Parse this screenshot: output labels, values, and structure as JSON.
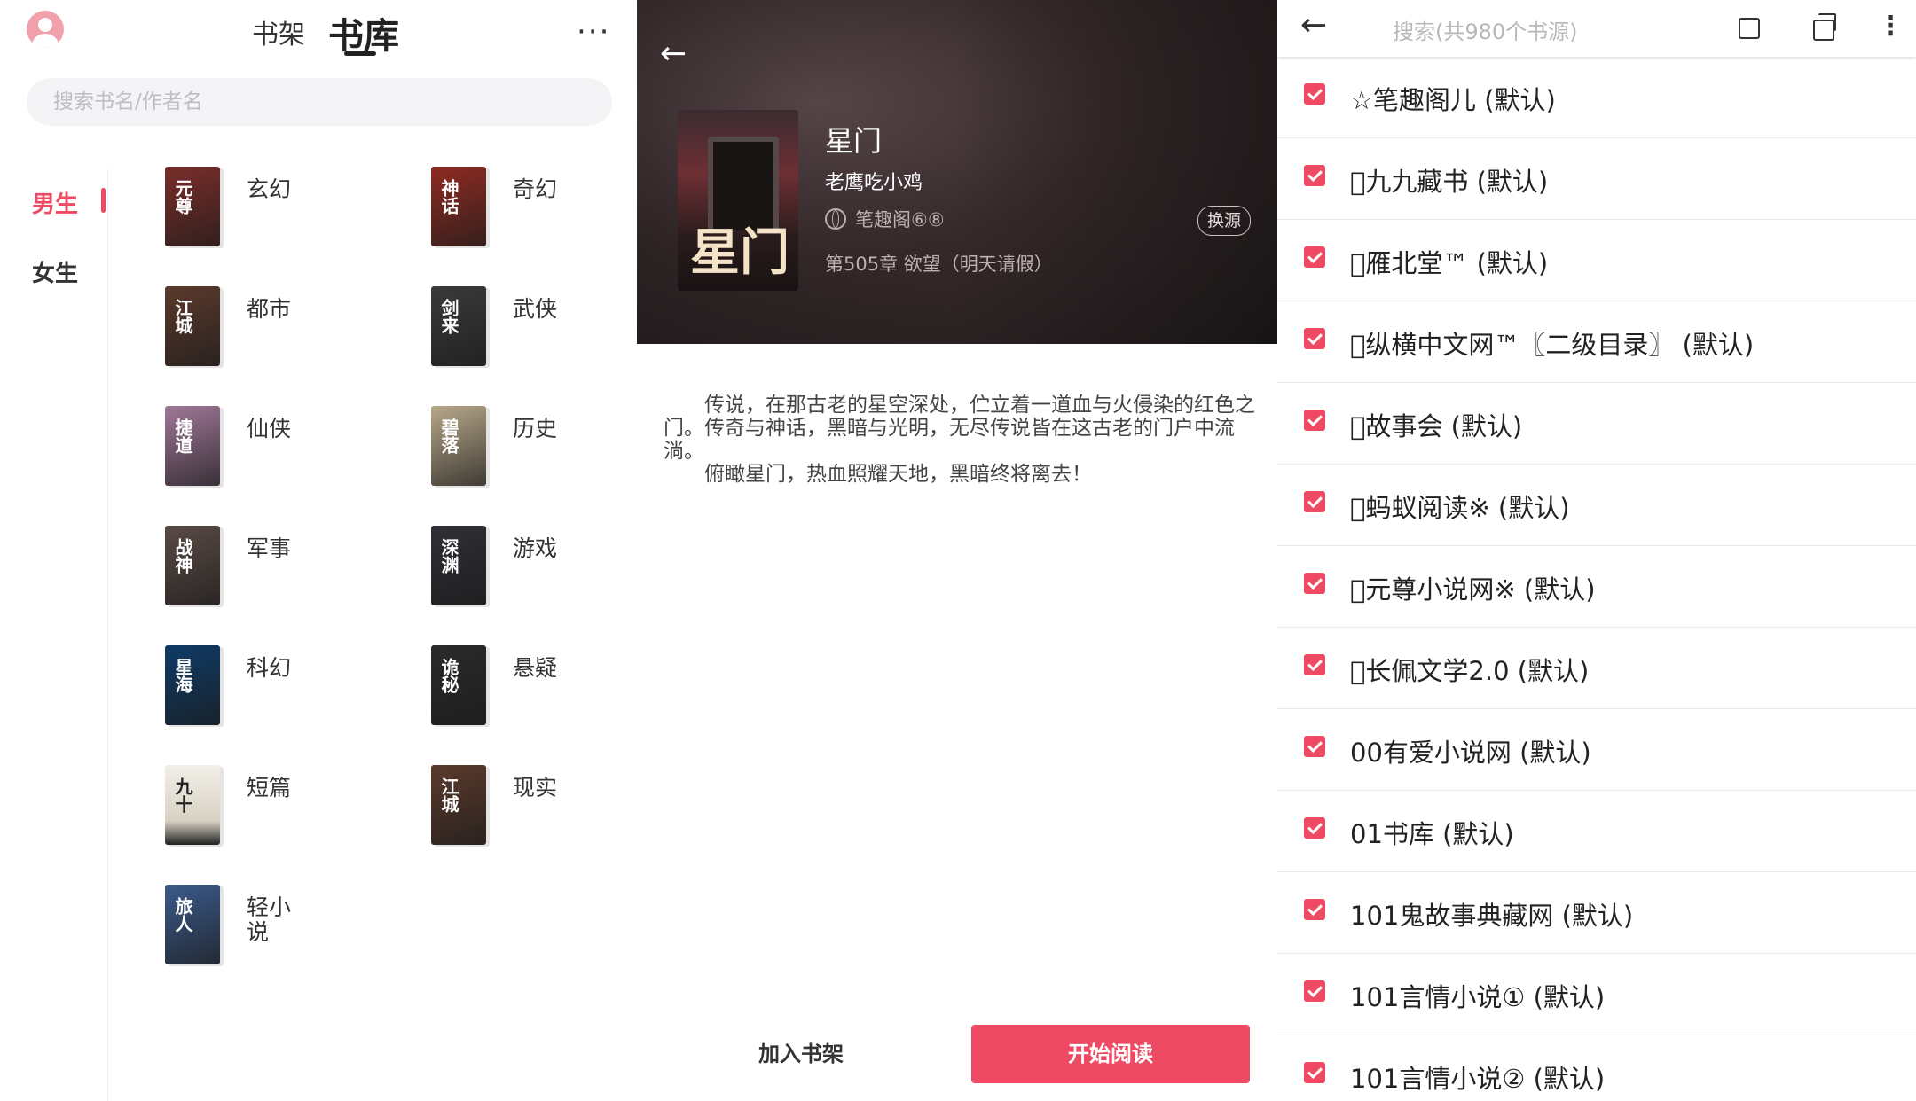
{
  "library": {
    "tabs": [
      "书架",
      "书库"
    ],
    "more": "···",
    "search_placeholder": "搜索书名/作者名",
    "genders": [
      "男生",
      "女生"
    ],
    "categories": [
      {
        "label": "玄幻",
        "cover_text": "元尊",
        "cover_color": "#7a2e2a"
      },
      {
        "label": "奇幻",
        "cover_text": "神话",
        "cover_color": "#8f2b22"
      },
      {
        "label": "都市",
        "cover_text": "江城",
        "cover_color": "#5b3a2c"
      },
      {
        "label": "武侠",
        "cover_text": "剑来",
        "cover_color": "#3a3a3a"
      },
      {
        "label": "仙侠",
        "cover_text": "捷道",
        "cover_color": "#a07898"
      },
      {
        "label": "历史",
        "cover_text": "碧落",
        "cover_color": "#b8a88a"
      },
      {
        "label": "军事",
        "cover_text": "战神",
        "cover_color": "#5a4a44"
      },
      {
        "label": "游戏",
        "cover_text": "深渊",
        "cover_color": "#2f2f35"
      },
      {
        "label": "科幻",
        "cover_text": "星海",
        "cover_color": "#0f3b66"
      },
      {
        "label": "悬疑",
        "cover_text": "诡秘",
        "cover_color": "#2a2a2a"
      },
      {
        "label": "短篇",
        "cover_text": "九十",
        "cover_color": "#e8e5dd"
      },
      {
        "label": "现实",
        "cover_text": "江城",
        "cover_color": "#5b3a2c"
      },
      {
        "label": "轻小说",
        "cover_text": "旅人",
        "cover_color": "#3b5a8a"
      }
    ]
  },
  "detail": {
    "back": "←",
    "cover_text": "星门",
    "title": "星门",
    "author": "老鹰吃小鸡",
    "source": "笔趣阁⑥⑧",
    "swap": "换源",
    "chapter": "第505章 欲望（明天请假）",
    "intro": [
      "传说，在那古老的星空深处，伫立着一道血与火侵染的红色之门。传奇与神话，黑暗与光明，无尽传说皆在这古老的门户中流淌。",
      "俯瞰星门，热血照耀天地，黑暗终将离去！"
    ],
    "add_shelf": "加入书架",
    "start_read": "开始阅读"
  },
  "sources": {
    "back": "←",
    "search_placeholder": "搜索(共980个书源)",
    "items": [
      "☆笔趣阁儿 (默认)",
      "󾭗九九藏书 (默认)",
      "󾭗雁北堂™ (默认)",
      "󾭗纵横中文网™〖二级目录〗 (默认)",
      "󾭗故事会 (默认)",
      "󾭗蚂蚁阅读※ (默认)",
      "󾭗元尊小说网※ (默认)",
      "󾭗长佩文学2.0 (默认)",
      "00有爱小说网 (默认)",
      "01书库 (默认)",
      "101鬼故事典藏网 (默认)",
      "101言情小说① (默认)",
      "101言情小说② (默认)"
    ],
    "accent": "#ef4a63"
  }
}
